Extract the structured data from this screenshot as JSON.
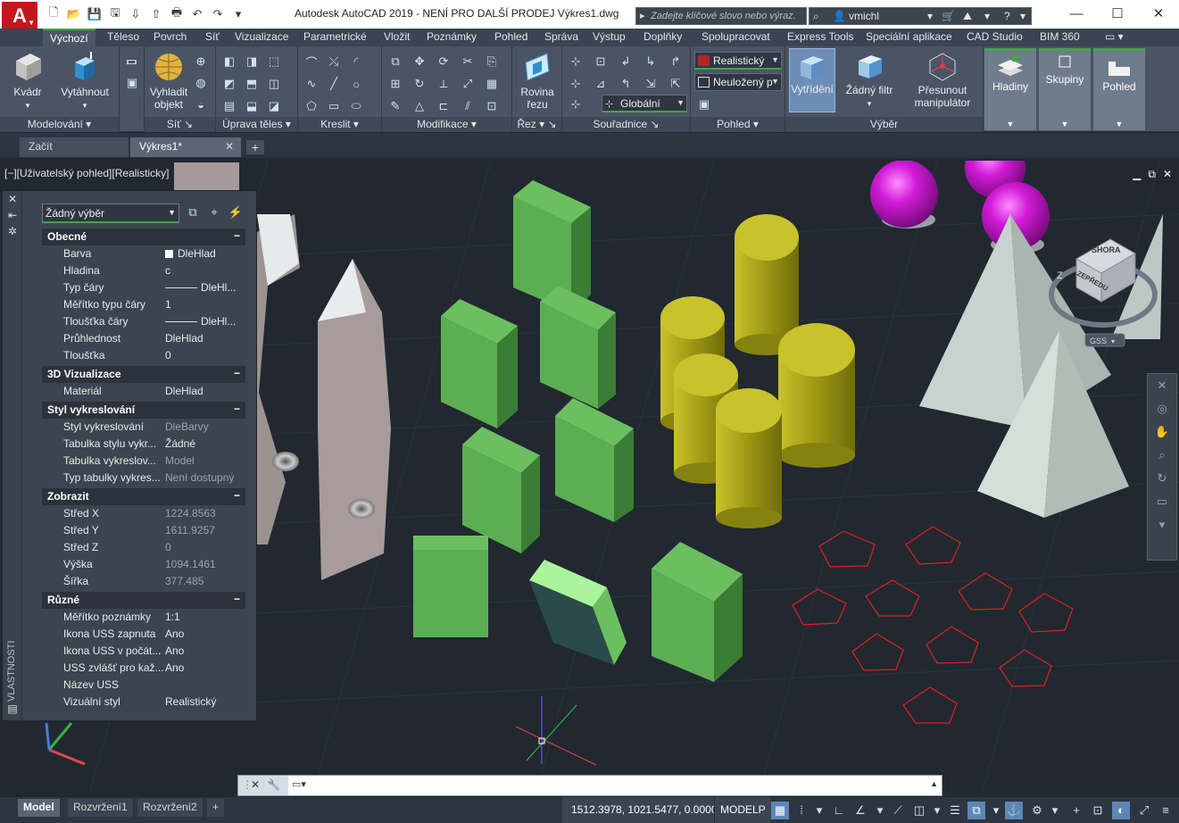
{
  "app": {
    "logo_letter": "A",
    "title": "Autodesk AutoCAD 2019 - NENÍ PRO DALŠÍ PRODEJ   Výkres1.dwg",
    "search_placeholder": "Zadejte klíčové slovo nebo výraz.",
    "user": "vmichl"
  },
  "ribbon_tabs": [
    "Výchozí",
    "Těleso",
    "Povrch",
    "Síť",
    "Vizualizace",
    "Parametrické",
    "Vložit",
    "Poznámky",
    "Pohled",
    "Správa",
    "Výstup",
    "Doplňky",
    "Spolupracovat",
    "Express Tools",
    "Speciální aplikace",
    "CAD Studio",
    "BIM 360"
  ],
  "ribbon": {
    "modelovani": {
      "title": "Modelování",
      "kvadr": "Kvádr",
      "vytahnout": "Vytáhnout"
    },
    "sit": {
      "title": "Síť",
      "vyhladit": "Vyhladit objekt"
    },
    "uprava_teles": {
      "title": "Úprava těles"
    },
    "kreslit": {
      "title": "Kreslit"
    },
    "modifikace": {
      "title": "Modifikace"
    },
    "rez": {
      "title": "Řez",
      "rovina": "Rovina řezu"
    },
    "souradnice": {
      "title": "Souřadnice",
      "combo": "Globální"
    },
    "pohled": {
      "title": "Pohled",
      "style_combo": "Realistický",
      "view_combo": "Neuložený p"
    },
    "vyber": {
      "title": "Výběr",
      "vytrideni": "Vytřídění",
      "filtr": "Žádný filtr",
      "manipulator": "Přesunout manipulátor"
    },
    "hladiny": "Hladiny",
    "skupiny": "Skupiny",
    "pohled_btn": "Pohled"
  },
  "file_tabs": [
    {
      "label": "Začít"
    },
    {
      "label": "Výkres1*"
    }
  ],
  "viewport": {
    "label": "[−][Uživatelský pohled][Realisticky]",
    "cube_top": "SHORA",
    "cube_front": "ZEPŘEDU",
    "compass_z": "Z",
    "wcs": "GSS"
  },
  "properties": {
    "palette_title": "VLASTNOSTI",
    "selection": "Žádný výběr",
    "sections": [
      {
        "title": "Obecné",
        "rows": [
          {
            "label": "Barva",
            "value": "DleHlad",
            "type": "color"
          },
          {
            "label": "Hladina",
            "value": "c"
          },
          {
            "label": "Typ čáry",
            "value": "DleHl...",
            "type": "line"
          },
          {
            "label": "Měřítko typu čáry",
            "value": "1"
          },
          {
            "label": "Tloušťka čáry",
            "value": "DleHl...",
            "type": "line"
          },
          {
            "label": "Průhlednost",
            "value": "DleHlad"
          },
          {
            "label": "Tloušťka",
            "value": "0"
          }
        ]
      },
      {
        "title": "3D Vizualizace",
        "rows": [
          {
            "label": "Materiál",
            "value": "DleHlad"
          }
        ]
      },
      {
        "title": "Styl vykreslování",
        "rows": [
          {
            "label": "Styl vykreslování",
            "value": "DleBarvy",
            "dim": true
          },
          {
            "label": "Tabulka stylu vykr...",
            "value": "Žádné"
          },
          {
            "label": "Tabulka vykreslov...",
            "value": "Model",
            "dim": true
          },
          {
            "label": "Typ tabulky vykres...",
            "value": "Není dostupný",
            "dim": true
          }
        ]
      },
      {
        "title": "Zobrazit",
        "rows": [
          {
            "label": "Střed X",
            "value": "1224.8563",
            "dim": true
          },
          {
            "label": "Střed Y",
            "value": "1611.9257",
            "dim": true
          },
          {
            "label": "Střed Z",
            "value": "0",
            "dim": true
          },
          {
            "label": "Výška",
            "value": "1094.1461",
            "dim": true
          },
          {
            "label": "Šířka",
            "value": "377.485",
            "dim": true
          }
        ]
      },
      {
        "title": "Různé",
        "rows": [
          {
            "label": "Měřítko poznámky",
            "value": "1:1"
          },
          {
            "label": "Ikona USS zapnuta",
            "value": "Ano"
          },
          {
            "label": "Ikona USS v počát...",
            "value": "Ano"
          },
          {
            "label": "USS zvlášť pro kaž...",
            "value": "Ano"
          },
          {
            "label": "Název USS",
            "value": ""
          },
          {
            "label": "Vizuální styl",
            "value": "Realistický"
          }
        ]
      }
    ]
  },
  "command_line": {
    "value": ""
  },
  "status": {
    "layout_tabs": [
      "Model",
      "Rozvržení1",
      "Rozvržení2"
    ],
    "coords": "1512.3978, 1021.5477, 0.0000",
    "modelp": "MODELP"
  },
  "colors": {
    "viewport_bg": "#212830",
    "ribbon_bg": "#4a5465",
    "green_box": "#5fae55",
    "yellow_cyl": "#a9a417",
    "magenta_sphere": "#c419c9",
    "pyramid": "#c5d1cc",
    "pentagon": "#e02020",
    "wall": "#a59a99",
    "accent": "#46a24b"
  }
}
